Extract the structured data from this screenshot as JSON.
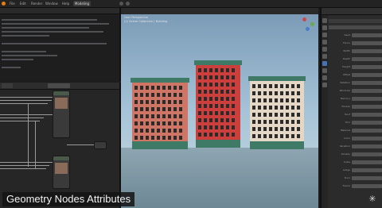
{
  "app": {
    "menu": [
      "File",
      "Edit",
      "Render",
      "Window",
      "Help"
    ],
    "workspace_tab": "Modeling",
    "accent_color": "#4772b3"
  },
  "editor": {
    "title": "Text Editor"
  },
  "nodes": {
    "header_tab": "Geometry Nodes"
  },
  "viewport": {
    "view_label": "User Perspective",
    "collection_label": "(1) Scene Collection | Building",
    "sky_color": "#9ab8cf",
    "building_colors": [
      "#d36a5b",
      "#cf3b3b",
      "#e6d8c8"
    ],
    "trim_color": "#3f7a67"
  },
  "properties": {
    "rows": [
      "Seed",
      "Floors",
      "Width",
      "Depth",
      "Height",
      "Offset",
      "Rotation",
      "Windows",
      "Balcony",
      "Facade",
      "Roof",
      "Trim",
      "Material",
      "Color",
      "Variation",
      "Density",
      "Scale",
      "Ledge",
      "Door",
      "Frame"
    ]
  },
  "caption": {
    "text": "Geometry Nodes Attributes"
  }
}
